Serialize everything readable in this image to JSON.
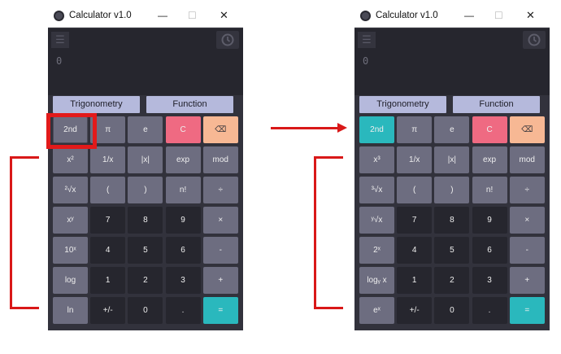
{
  "left": {
    "title": "Calculator v1.0",
    "display_value": "0",
    "mode_buttons": [
      "Trigonometry",
      "Function"
    ],
    "keys": [
      "2nd",
      "π",
      "e",
      "C",
      "⌫",
      "x²",
      "1/x",
      "|x|",
      "exp",
      "mod",
      "²√x",
      "(",
      ")",
      "n!",
      "÷",
      "xʸ",
      "7",
      "8",
      "9",
      "×",
      "10ˣ",
      "4",
      "5",
      "6",
      "-",
      "log",
      "1",
      "2",
      "3",
      "+",
      "ln",
      "+/-",
      "0",
      ".",
      "="
    ]
  },
  "right": {
    "title": "Calculator v1.0",
    "display_value": "0",
    "mode_buttons": [
      "Trigonometry",
      "Function"
    ],
    "keys": [
      "2nd",
      "π",
      "e",
      "C",
      "⌫",
      "x³",
      "1/x",
      "|x|",
      "exp",
      "mod",
      "³√x",
      "(",
      ")",
      "n!",
      "÷",
      "ʸ√x",
      "7",
      "8",
      "9",
      "×",
      "2ˣ",
      "4",
      "5",
      "6",
      "-",
      "logᵧ x",
      "1",
      "2",
      "3",
      "+",
      "eˣ",
      "+/-",
      "0",
      ".",
      "="
    ]
  },
  "window_controls": {
    "minimize": "—",
    "maximize": "☐",
    "close": "✕"
  },
  "icons": {
    "menu": "hamburger-icon",
    "history": "history-icon",
    "app": "calculator-app-icon"
  },
  "colors": {
    "accent_teal": "#2ab8bd",
    "clear_pink": "#ef6a82",
    "backspace_peach": "#f7b894",
    "mode_lavender": "#b5b9dc",
    "annotation_red": "#d91818"
  }
}
